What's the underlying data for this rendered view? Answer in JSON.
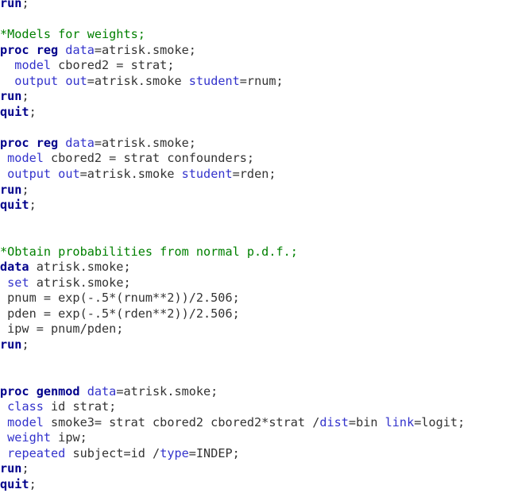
{
  "editor": {
    "language": "SAS",
    "background_color": "#ffffff",
    "colors": {
      "keyword": "#00008B",
      "option_keyword": "#3333CC",
      "comment": "#008000",
      "text": "#333333"
    }
  },
  "code_lines": [
    {
      "id": "line-1",
      "type": "code",
      "tokens": [
        {
          "cls": "kw",
          "t": "run"
        },
        {
          "cls": "txt",
          "t": ";"
        }
      ]
    },
    {
      "id": "line-2",
      "type": "blank",
      "tokens": []
    },
    {
      "id": "line-3",
      "type": "comment",
      "tokens": [
        {
          "cls": "cmt",
          "t": "*Models for weights;"
        }
      ]
    },
    {
      "id": "line-4",
      "type": "code",
      "tokens": [
        {
          "cls": "kw",
          "t": "proc reg "
        },
        {
          "cls": "opt",
          "t": "data"
        },
        {
          "cls": "txt",
          "t": "=atrisk.smoke;"
        }
      ]
    },
    {
      "id": "line-5",
      "type": "code",
      "tokens": [
        {
          "cls": "txt",
          "t": "  "
        },
        {
          "cls": "opt",
          "t": "model"
        },
        {
          "cls": "txt",
          "t": " cbored2 = strat;"
        }
      ]
    },
    {
      "id": "line-6",
      "type": "code",
      "tokens": [
        {
          "cls": "txt",
          "t": "  "
        },
        {
          "cls": "opt",
          "t": "output "
        },
        {
          "cls": "opt",
          "t": "out"
        },
        {
          "cls": "txt",
          "t": "=atrisk.smoke "
        },
        {
          "cls": "opt",
          "t": "student"
        },
        {
          "cls": "txt",
          "t": "=rnum;"
        }
      ]
    },
    {
      "id": "line-7",
      "type": "code",
      "tokens": [
        {
          "cls": "kw",
          "t": "run"
        },
        {
          "cls": "txt",
          "t": ";"
        }
      ]
    },
    {
      "id": "line-8",
      "type": "code",
      "tokens": [
        {
          "cls": "kw",
          "t": "quit"
        },
        {
          "cls": "txt",
          "t": ";"
        }
      ]
    },
    {
      "id": "line-9",
      "type": "blank",
      "tokens": []
    },
    {
      "id": "line-10",
      "type": "code",
      "tokens": [
        {
          "cls": "kw",
          "t": "proc reg "
        },
        {
          "cls": "opt",
          "t": "data"
        },
        {
          "cls": "txt",
          "t": "=atrisk.smoke;"
        }
      ]
    },
    {
      "id": "line-11",
      "type": "code",
      "tokens": [
        {
          "cls": "txt",
          "t": " "
        },
        {
          "cls": "opt",
          "t": "model"
        },
        {
          "cls": "txt",
          "t": " cbored2 = strat confounders;"
        }
      ]
    },
    {
      "id": "line-12",
      "type": "code",
      "tokens": [
        {
          "cls": "txt",
          "t": " "
        },
        {
          "cls": "opt",
          "t": "output "
        },
        {
          "cls": "opt",
          "t": "out"
        },
        {
          "cls": "txt",
          "t": "=atrisk.smoke "
        },
        {
          "cls": "opt",
          "t": "student"
        },
        {
          "cls": "txt",
          "t": "=rden;"
        }
      ]
    },
    {
      "id": "line-13",
      "type": "code",
      "tokens": [
        {
          "cls": "kw",
          "t": "run"
        },
        {
          "cls": "txt",
          "t": ";"
        }
      ]
    },
    {
      "id": "line-14",
      "type": "code",
      "tokens": [
        {
          "cls": "kw",
          "t": "quit"
        },
        {
          "cls": "txt",
          "t": ";"
        }
      ]
    },
    {
      "id": "line-15",
      "type": "blank",
      "tokens": []
    },
    {
      "id": "line-16",
      "type": "blank",
      "tokens": []
    },
    {
      "id": "line-17",
      "type": "comment",
      "tokens": [
        {
          "cls": "cmt",
          "t": "*Obtain probabilities from normal p.d.f.;"
        }
      ]
    },
    {
      "id": "line-18",
      "type": "code",
      "tokens": [
        {
          "cls": "kw",
          "t": "data"
        },
        {
          "cls": "txt",
          "t": " atrisk.smoke;"
        }
      ]
    },
    {
      "id": "line-19",
      "type": "code",
      "tokens": [
        {
          "cls": "txt",
          "t": " "
        },
        {
          "cls": "opt",
          "t": "set"
        },
        {
          "cls": "txt",
          "t": " atrisk.smoke;"
        }
      ]
    },
    {
      "id": "line-20",
      "type": "code",
      "tokens": [
        {
          "cls": "txt",
          "t": " pnum = exp(-.5*(rnum**2))/2.506;"
        }
      ]
    },
    {
      "id": "line-21",
      "type": "code",
      "tokens": [
        {
          "cls": "txt",
          "t": " pden = exp(-.5*(rden**2))/2.506;"
        }
      ]
    },
    {
      "id": "line-22",
      "type": "code",
      "tokens": [
        {
          "cls": "txt",
          "t": " ipw = pnum/pden;"
        }
      ]
    },
    {
      "id": "line-23",
      "type": "code",
      "tokens": [
        {
          "cls": "kw",
          "t": "run"
        },
        {
          "cls": "txt",
          "t": ";"
        }
      ]
    },
    {
      "id": "line-24",
      "type": "blank",
      "tokens": []
    },
    {
      "id": "line-25",
      "type": "blank",
      "tokens": []
    },
    {
      "id": "line-26",
      "type": "code",
      "tokens": [
        {
          "cls": "kw",
          "t": "proc genmod "
        },
        {
          "cls": "opt",
          "t": "data"
        },
        {
          "cls": "txt",
          "t": "=atrisk.smoke;"
        }
      ]
    },
    {
      "id": "line-27",
      "type": "code",
      "tokens": [
        {
          "cls": "txt",
          "t": " "
        },
        {
          "cls": "opt",
          "t": "class"
        },
        {
          "cls": "txt",
          "t": " id strat;"
        }
      ]
    },
    {
      "id": "line-28",
      "type": "code",
      "tokens": [
        {
          "cls": "txt",
          "t": " "
        },
        {
          "cls": "opt",
          "t": "model"
        },
        {
          "cls": "txt",
          "t": " smoke3= strat cbored2 cbored2*strat /"
        },
        {
          "cls": "opt",
          "t": "dist"
        },
        {
          "cls": "txt",
          "t": "=bin "
        },
        {
          "cls": "opt",
          "t": "link"
        },
        {
          "cls": "txt",
          "t": "=logit;"
        }
      ]
    },
    {
      "id": "line-29",
      "type": "code",
      "tokens": [
        {
          "cls": "txt",
          "t": " "
        },
        {
          "cls": "opt",
          "t": "weight"
        },
        {
          "cls": "txt",
          "t": " ipw;"
        }
      ]
    },
    {
      "id": "line-30",
      "type": "code",
      "tokens": [
        {
          "cls": "txt",
          "t": " "
        },
        {
          "cls": "opt",
          "t": "repeated"
        },
        {
          "cls": "txt",
          "t": " subject=id /"
        },
        {
          "cls": "opt",
          "t": "type"
        },
        {
          "cls": "txt",
          "t": "=INDEP;"
        }
      ]
    },
    {
      "id": "line-31",
      "type": "code",
      "tokens": [
        {
          "cls": "kw",
          "t": "run"
        },
        {
          "cls": "txt",
          "t": ";"
        }
      ]
    },
    {
      "id": "line-32",
      "type": "code",
      "tokens": [
        {
          "cls": "kw",
          "t": "quit"
        },
        {
          "cls": "txt",
          "t": ";"
        }
      ]
    }
  ]
}
